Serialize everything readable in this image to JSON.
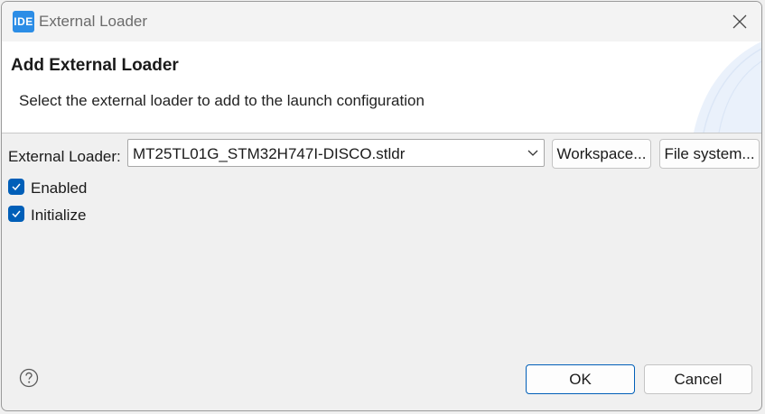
{
  "window": {
    "app_icon_text": "IDE",
    "title": "External Loader",
    "close_icon": "close-icon"
  },
  "header": {
    "title": "Add External Loader",
    "description": "Select the external loader to add to the launch configuration"
  },
  "form": {
    "loader_label": "External Loader:",
    "loader_value": "MT25TL01G_STM32H747I-DISCO.stldr",
    "workspace_button": "Workspace...",
    "filesystem_button": "File system...",
    "enabled_label": "Enabled",
    "enabled_checked": true,
    "initialize_label": "Initialize",
    "initialize_checked": true
  },
  "footer": {
    "help_icon": "help-icon",
    "ok_label": "OK",
    "cancel_label": "Cancel"
  },
  "colors": {
    "accent": "#005fb8",
    "app_icon": "#2c8de6",
    "header_bg": "#ffffff",
    "dialog_bg": "#f0f0f0"
  }
}
